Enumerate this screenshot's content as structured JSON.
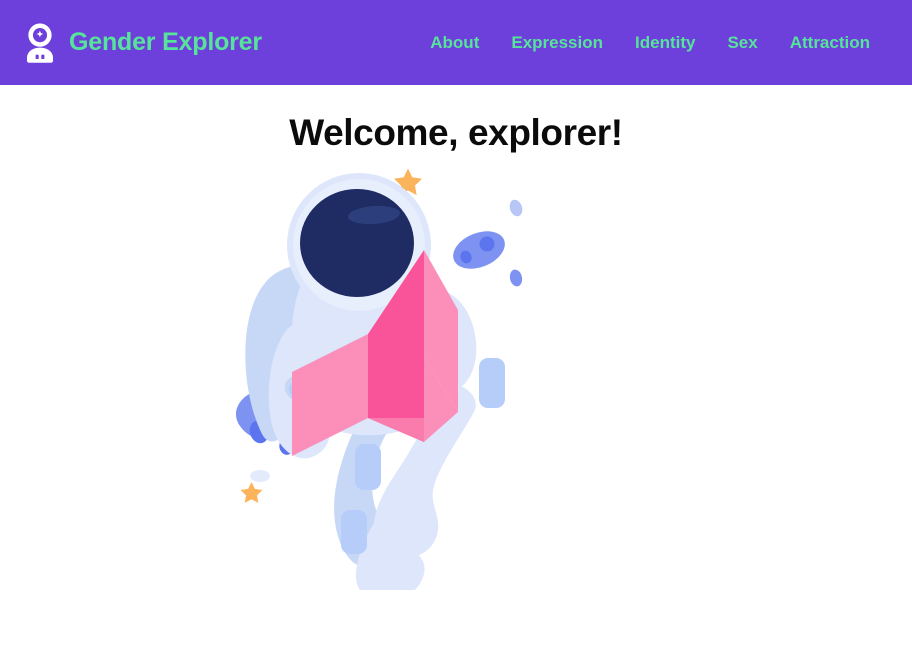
{
  "header": {
    "background_color": "#6D3FDB",
    "brand": {
      "logo_icon": "astronaut-icon",
      "name": "Gender Explorer",
      "text_color": "#56E49B"
    },
    "nav": {
      "items": [
        {
          "label": "About"
        },
        {
          "label": "Expression"
        },
        {
          "label": "Identity"
        },
        {
          "label": "Sex"
        },
        {
          "label": "Attraction"
        }
      ]
    }
  },
  "main": {
    "title": "Welcome, explorer!",
    "title_color": "#0b0b0b",
    "background_color": "#ffffff",
    "illustration": {
      "name": "astronaut-reading-book-illustration",
      "alt": "Astronaut floating in space reading a pink book surrounded by stars and asteroids",
      "colors": {
        "suit_light": "#DDE6FB",
        "suit_shadow": "#C7D7F6",
        "suit_patch": "#B6CDFA",
        "helmet_glass": "#1F2B63",
        "helmet_glass_highlight": "#2D3E7C",
        "book_page": "#FB8FB9",
        "book_spine": "#F9549A",
        "asteroid": "#7E92F2",
        "asteroid_crater": "#5C74EE",
        "star": "#FBB45C",
        "faint_ellipse": "#E3EAFB"
      }
    }
  }
}
